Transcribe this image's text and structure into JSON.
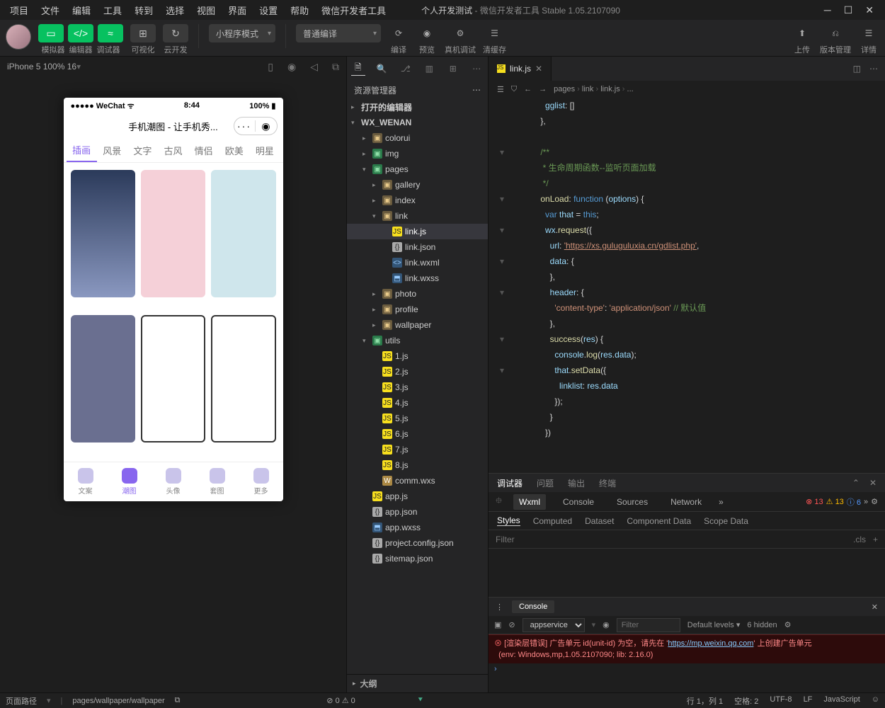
{
  "menu": {
    "items": [
      "项目",
      "文件",
      "编辑",
      "工具",
      "转到",
      "选择",
      "视图",
      "界面",
      "设置",
      "帮助",
      "微信开发者工具"
    ]
  },
  "title": {
    "app": "个人开发测试",
    "suffix": " - 微信开发者工具 Stable 1.05.2107090"
  },
  "toolbar": {
    "row1": {
      "sim": "模拟器",
      "edit": "编辑器",
      "debug": "调试器",
      "vis": "可视化",
      "cloud": "云开发"
    },
    "mode": "小程序模式",
    "compile": "普通编译",
    "row2": {
      "compile_lbl": "编译",
      "preview": "预览",
      "realdebug": "真机调试",
      "clearcache": "清缓存"
    },
    "right": {
      "upload": "上传",
      "version": "版本管理",
      "detail": "详情"
    }
  },
  "simulator": {
    "device": "iPhone 5 100% 16",
    "statusCarrier": "●●●●● WeChat",
    "statusTime": "8:44",
    "statusBatt": "100%",
    "navTitle": "手机潮图 - 让手机秀...",
    "tabs": [
      "插画",
      "风景",
      "文字",
      "古风",
      "情侣",
      "欧美",
      "明星"
    ],
    "activeTab": 0,
    "tabbar": [
      {
        "l": "文案"
      },
      {
        "l": "潮图"
      },
      {
        "l": "头像"
      },
      {
        "l": "套图"
      },
      {
        "l": "更多"
      }
    ],
    "activeTabbar": 1
  },
  "explorer": {
    "title": "资源管理器",
    "openEditors": "打开的编辑器",
    "root": "WX_WENAN",
    "outline": "大纲",
    "tree": [
      {
        "d": 1,
        "arr": "▸",
        "icon": "folder",
        "name": "colorui"
      },
      {
        "d": 1,
        "arr": "▸",
        "icon": "folder comp",
        "name": "img"
      },
      {
        "d": 1,
        "arr": "▾",
        "icon": "folder comp open",
        "name": "pages"
      },
      {
        "d": 2,
        "arr": "▸",
        "icon": "folder",
        "name": "gallery"
      },
      {
        "d": 2,
        "arr": "▸",
        "icon": "folder",
        "name": "index"
      },
      {
        "d": 2,
        "arr": "▾",
        "icon": "folder open",
        "name": "link"
      },
      {
        "d": 3,
        "arr": "",
        "icon": "js",
        "name": "link.js",
        "sel": true
      },
      {
        "d": 3,
        "arr": "",
        "icon": "json",
        "name": "link.json"
      },
      {
        "d": 3,
        "arr": "",
        "icon": "wxml",
        "name": "link.wxml"
      },
      {
        "d": 3,
        "arr": "",
        "icon": "wxss",
        "name": "link.wxss"
      },
      {
        "d": 2,
        "arr": "▸",
        "icon": "folder",
        "name": "photo"
      },
      {
        "d": 2,
        "arr": "▸",
        "icon": "folder",
        "name": "profile"
      },
      {
        "d": 2,
        "arr": "▸",
        "icon": "folder",
        "name": "wallpaper"
      },
      {
        "d": 1,
        "arr": "▾",
        "icon": "folder comp open",
        "name": "utils"
      },
      {
        "d": 2,
        "arr": "",
        "icon": "js",
        "name": "1.js"
      },
      {
        "d": 2,
        "arr": "",
        "icon": "js",
        "name": "2.js"
      },
      {
        "d": 2,
        "arr": "",
        "icon": "js",
        "name": "3.js"
      },
      {
        "d": 2,
        "arr": "",
        "icon": "js",
        "name": "4.js"
      },
      {
        "d": 2,
        "arr": "",
        "icon": "js",
        "name": "5.js"
      },
      {
        "d": 2,
        "arr": "",
        "icon": "js",
        "name": "6.js"
      },
      {
        "d": 2,
        "arr": "",
        "icon": "js",
        "name": "7.js"
      },
      {
        "d": 2,
        "arr": "",
        "icon": "js",
        "name": "8.js"
      },
      {
        "d": 2,
        "arr": "",
        "icon": "wxs",
        "name": "comm.wxs"
      },
      {
        "d": 1,
        "arr": "",
        "icon": "js",
        "name": "app.js"
      },
      {
        "d": 1,
        "arr": "",
        "icon": "json",
        "name": "app.json"
      },
      {
        "d": 1,
        "arr": "",
        "icon": "wxss",
        "name": "app.wxss"
      },
      {
        "d": 1,
        "arr": "",
        "icon": "json",
        "name": "project.config.json"
      },
      {
        "d": 1,
        "arr": "",
        "icon": "json",
        "name": "sitemap.json"
      }
    ]
  },
  "editor": {
    "tab": "link.js",
    "crumbs": [
      "pages",
      "link",
      "link.js",
      "..."
    ],
    "lines": [
      {
        "n": "",
        "fold": "",
        "html": "      <span class='c-prop'>gglist</span>: []"
      },
      {
        "n": "",
        "fold": "",
        "html": "    },"
      },
      {
        "n": "",
        "fold": "",
        "html": ""
      },
      {
        "n": "",
        "fold": "▾",
        "html": "    <span class='c-com'>/**</span>"
      },
      {
        "n": "",
        "fold": "",
        "html": "<span class='c-com'>     * 生命周期函数--监听页面加载</span>"
      },
      {
        "n": "",
        "fold": "",
        "html": "<span class='c-com'>     */</span>"
      },
      {
        "n": "",
        "fold": "▾",
        "html": "    <span class='c-fn'>onLoad</span>: <span class='c-key'>function</span> (<span class='c-prop'>options</span>) {"
      },
      {
        "n": "",
        "fold": "",
        "html": "      <span class='c-key'>var</span> <span class='c-prop'>that</span> = <span class='c-key'>this</span>;"
      },
      {
        "n": "",
        "fold": "▾",
        "html": "      <span class='c-prop'>wx</span>.<span class='c-fn'>request</span>({"
      },
      {
        "n": "",
        "fold": "",
        "html": "        <span class='c-prop'>url</span>: <span class='c-url'>'https://xs.guluguluxia.cn/gdlist.php'</span>,"
      },
      {
        "n": "",
        "fold": "▾",
        "html": "        <span class='c-prop'>data</span>: {"
      },
      {
        "n": "",
        "fold": "",
        "html": "        },"
      },
      {
        "n": "",
        "fold": "▾",
        "html": "        <span class='c-prop'>header</span>: {"
      },
      {
        "n": "",
        "fold": "",
        "html": "          <span class='c-str'>'content-type'</span>: <span class='c-str'>'application/json'</span> <span class='c-com'>// 默认值</span>"
      },
      {
        "n": "",
        "fold": "",
        "html": "        },"
      },
      {
        "n": "",
        "fold": "▾",
        "html": "        <span class='c-fn'>success</span>(<span class='c-prop'>res</span>) {"
      },
      {
        "n": "",
        "fold": "",
        "html": "          <span class='c-prop'>console</span>.<span class='c-fn'>log</span>(<span class='c-prop'>res</span>.<span class='c-prop'>data</span>);"
      },
      {
        "n": "",
        "fold": "▾",
        "html": "          <span class='c-prop'>that</span>.<span class='c-fn'>setData</span>({"
      },
      {
        "n": "",
        "fold": "",
        "html": "            <span class='c-prop'>linklist</span>: <span class='c-prop'>res</span>.<span class='c-prop'>data</span>"
      },
      {
        "n": "",
        "fold": "",
        "html": "          });"
      },
      {
        "n": "",
        "fold": "",
        "html": "        }"
      },
      {
        "n": "",
        "fold": "",
        "html": "      })"
      }
    ]
  },
  "debugger": {
    "tabs": [
      "调试器",
      "问题",
      "输出",
      "终端"
    ],
    "activeTab": 0,
    "tools": [
      "Wxml",
      "Console",
      "Sources",
      "Network"
    ],
    "activeTool": 0,
    "errors": "13",
    "warnings": "13",
    "info": "6",
    "subtabs": [
      "Styles",
      "Computed",
      "Dataset",
      "Component Data",
      "Scope Data"
    ],
    "activeSub": 0,
    "filter_ph": "Filter",
    "cls": ".cls"
  },
  "console": {
    "title": "Console",
    "context": "appservice",
    "filter_ph": "Filter",
    "levels": "Default levels",
    "hidden": "6 hidden",
    "err1": "[渲染层错误] 广告单元 id(unit-id) 为空，请先在 '",
    "errlink": "https://mp.weixin.qq.com",
    "err1b": "' 上创建广告单元",
    "err2": "(env: Windows,mp,1.05.2107090; lib: 2.16.0)"
  },
  "status": {
    "left": "页面路径",
    "path": "pages/wallpaper/wallpaper",
    "warn": "⊘ 0 ⚠ 0",
    "right": {
      "pos": "行 1，列 1",
      "spaces": "空格: 2",
      "enc": "UTF-8",
      "eol": "LF",
      "lang": "JavaScript"
    }
  }
}
